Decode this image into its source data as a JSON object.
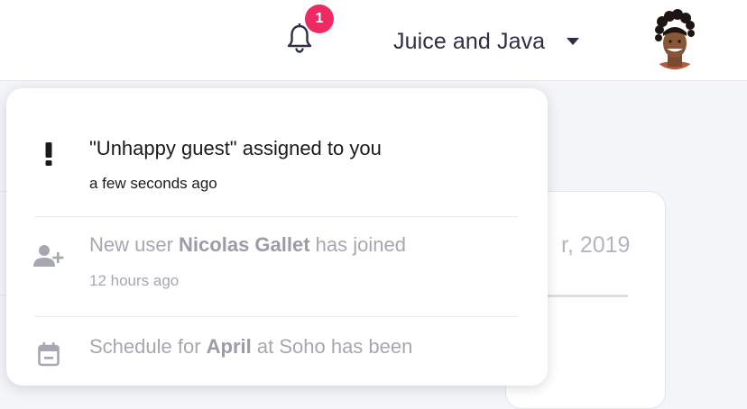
{
  "header": {
    "notification_count": "1",
    "organization_name": "Juice and Java",
    "colors": {
      "badge": "#ee2a62",
      "text_primary": "#2c2f45"
    }
  },
  "background": {
    "date_fragment": "r, 2019"
  },
  "notifications": [
    {
      "icon": "exclamation-icon",
      "title": "\"Unhappy guest\" assigned to you",
      "time": "a few seconds ago",
      "unread": true
    },
    {
      "icon": "user-plus-icon",
      "title_prefix": "New user ",
      "title_bold": "Nicolas Gallet",
      "title_suffix": " has joined",
      "time": "12 hours ago",
      "unread": false
    },
    {
      "icon": "calendar-icon",
      "title_prefix": "Schedule for ",
      "title_bold": "April",
      "title_suffix": " at Soho has been",
      "unread": false
    }
  ]
}
